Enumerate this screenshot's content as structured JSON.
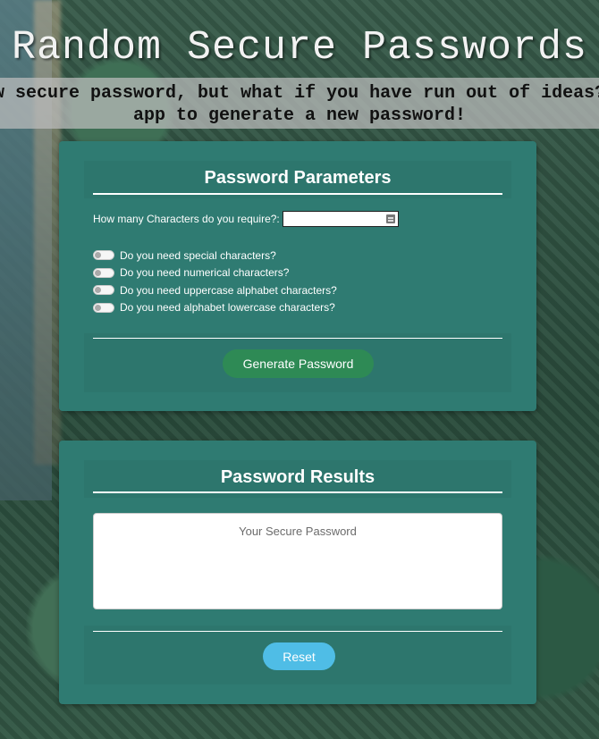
{
  "header": {
    "title": "Random Secure Passwords",
    "subtitle_line1": "Need a new secure password, but what if you have run out of ideas? Use this",
    "subtitle_line2": "app to generate a new password!"
  },
  "params_panel": {
    "title": "Password Parameters",
    "length_label": "How many Characters do you require?:",
    "length_value": "",
    "toggles": [
      {
        "label": "Do you need special characters?",
        "checked": false
      },
      {
        "label": "Do you need numerical characters?",
        "checked": false
      },
      {
        "label": "Do you need uppercase alphabet characters?",
        "checked": false
      },
      {
        "label": "Do you need alphabet lowercase characters?",
        "checked": false
      }
    ],
    "generate_label": "Generate Password"
  },
  "results_panel": {
    "title": "Password Results",
    "password_placeholder": "Your Secure Password",
    "reset_label": "Reset"
  },
  "colors": {
    "panel": "#2f7b72",
    "generate": "#2e8a55",
    "reset": "#4fbde6"
  }
}
